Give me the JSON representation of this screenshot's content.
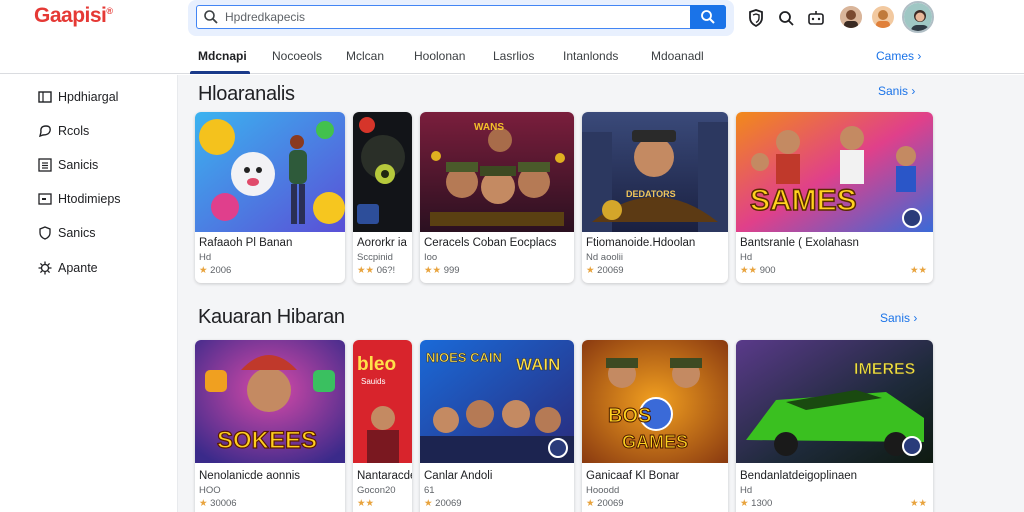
{
  "header": {
    "logo_text": "Gaapisi",
    "search": {
      "value": "Hpdredkapecis",
      "placeholder": "Hpdredkapecis"
    }
  },
  "tabs": {
    "items": [
      {
        "label": "Mdcnapi"
      },
      {
        "label": "Nocoeols"
      },
      {
        "label": "Mclcan"
      },
      {
        "label": "Hoolonan"
      },
      {
        "label": "Lasrlios"
      },
      {
        "label": "Intanlonds"
      },
      {
        "label": "Mdoanadl"
      }
    ],
    "more_label": "Cames"
  },
  "sidebar": {
    "items": [
      {
        "label": "Hpdhiargal",
        "icon": "window-icon"
      },
      {
        "label": "Rcols",
        "icon": "chat-icon"
      },
      {
        "label": "Sanicis",
        "icon": "grid-icon"
      },
      {
        "label": "Htodimieps",
        "icon": "folder-icon"
      },
      {
        "label": "Sanics",
        "icon": "shield-icon"
      },
      {
        "label": "Apante",
        "icon": "gear-icon"
      }
    ]
  },
  "sections": [
    {
      "title": "Hloaranalis",
      "more_label": "Sanis",
      "cards": [
        {
          "title": "Rafaaoh Pl Banan",
          "sub": "Hd",
          "rating": "2006",
          "stars": 1
        },
        {
          "title": "Aororkr ia",
          "sub": "Sccpinid",
          "rating": "06?!",
          "stars": 2
        },
        {
          "title": "Ceracels Coban Eocplacs",
          "sub": "Ioo",
          "rating": "999",
          "stars": 2
        },
        {
          "title": "Ftiomanoide.Hdoolan",
          "sub": "Nd aoolii",
          "rating": "20069",
          "stars": 1
        },
        {
          "title": "Bantsranle ( Exolahasn",
          "sub": "Hd",
          "rating": "900",
          "stars": 2,
          "right_stars": 2
        }
      ]
    },
    {
      "title": "Kauaran Hibaran",
      "more_label": "Sanis",
      "cards": [
        {
          "title": "Nenolanicde aonnis",
          "sub": "HOO",
          "rating": "30006",
          "stars": 1
        },
        {
          "title": "Nantaracde",
          "sub": "Gocon20",
          "rating": "",
          "stars": 2
        },
        {
          "title": "Canlar Andoli",
          "sub": "61",
          "rating": "20069",
          "stars": 1
        },
        {
          "title": "Ganicaaf Kl Bonar",
          "sub": "Hooodd",
          "rating": "20069",
          "stars": 1
        },
        {
          "title": "Bendanlatdeigoplinaen",
          "sub": "Hd",
          "rating": "1300",
          "stars": 1,
          "right_stars": 2
        }
      ]
    }
  ],
  "art_text": {
    "s1c3": "WANS",
    "s1c4": "DEDATORS",
    "s1c5": "SAMES",
    "s2c1": "SOKEES",
    "s2c2": "bleo",
    "s2c2_sub": "Sauids",
    "s2c3": "NIOES CAIN",
    "s2c3b": "WAIN",
    "s2c4": "BOS",
    "s2c4b": "GAMES",
    "s2c5": "IMERES"
  },
  "colors": {
    "accent": "#1a73e8",
    "tab_underline": "#1a3a8a",
    "star": "#e8a33d"
  }
}
